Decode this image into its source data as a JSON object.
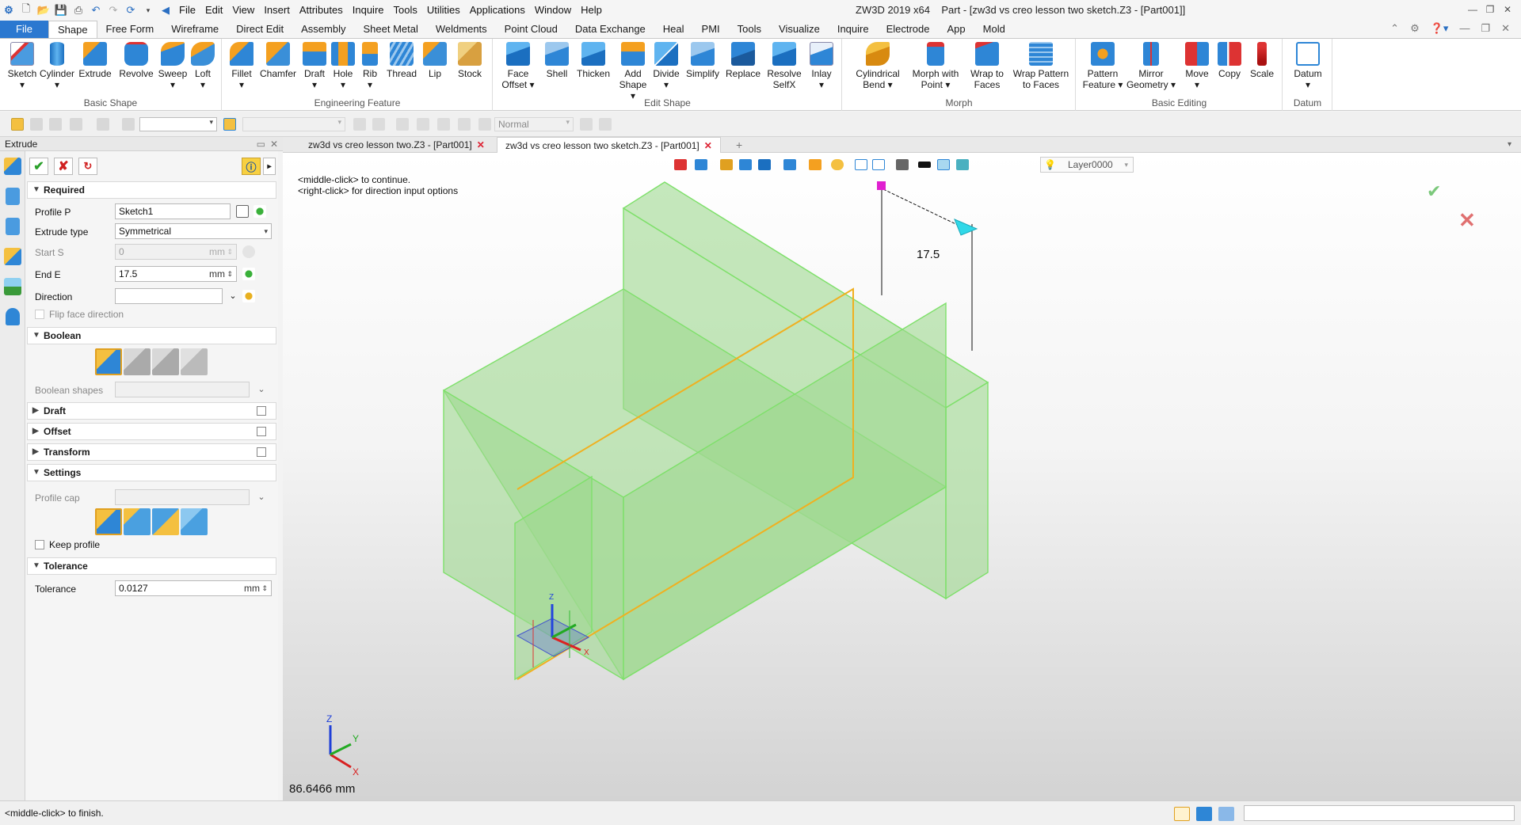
{
  "titlebar": {
    "menus": [
      "File",
      "Edit",
      "View",
      "Insert",
      "Attributes",
      "Inquire",
      "Tools",
      "Utilities",
      "Applications",
      "Window",
      "Help"
    ],
    "app_title": "ZW3D 2019  x64",
    "doc_title": "Part - [zw3d vs creo lesson two sketch.Z3 - [Part001]]"
  },
  "ribbon_tabs": [
    "File",
    "Shape",
    "Free Form",
    "Wireframe",
    "Direct Edit",
    "Assembly",
    "Sheet Metal",
    "Weldments",
    "Point Cloud",
    "Data Exchange",
    "Heal",
    "PMI",
    "Tools",
    "Visualize",
    "Inquire",
    "Electrode",
    "App",
    "Mold"
  ],
  "ribbon_active": "Shape",
  "ribbon_groups": {
    "basic_shape": {
      "label": "Basic Shape",
      "buttons": [
        {
          "line1": "Sketch",
          "line2": "▾"
        },
        {
          "line1": "Cylinder",
          "line2": "▾"
        },
        {
          "line1": "Extrude",
          "line2": ""
        },
        {
          "line1": "Revolve",
          "line2": ""
        },
        {
          "line1": "Sweep",
          "line2": "▾"
        },
        {
          "line1": "Loft",
          "line2": "▾"
        }
      ]
    },
    "engineering_feature": {
      "label": "Engineering Feature",
      "buttons": [
        {
          "line1": "Fillet",
          "line2": "▾"
        },
        {
          "line1": "Chamfer",
          "line2": ""
        },
        {
          "line1": "Draft",
          "line2": "▾"
        },
        {
          "line1": "Hole",
          "line2": "▾"
        },
        {
          "line1": "Rib",
          "line2": "▾"
        },
        {
          "line1": "Thread",
          "line2": ""
        },
        {
          "line1": "Lip",
          "line2": ""
        },
        {
          "line1": "Stock",
          "line2": ""
        }
      ]
    },
    "edit_shape": {
      "label": "Edit Shape",
      "buttons": [
        {
          "line1": "Face",
          "line2": "Offset ▾"
        },
        {
          "line1": "Shell",
          "line2": ""
        },
        {
          "line1": "Thicken",
          "line2": ""
        },
        {
          "line1": "Add",
          "line2": "Shape ▾"
        },
        {
          "line1": "Divide",
          "line2": "▾"
        },
        {
          "line1": "Simplify",
          "line2": ""
        },
        {
          "line1": "Replace",
          "line2": ""
        },
        {
          "line1": "Resolve",
          "line2": "SelfX"
        },
        {
          "line1": "Inlay",
          "line2": "▾"
        }
      ]
    },
    "morph": {
      "label": "Morph",
      "buttons": [
        {
          "line1": "Cylindrical",
          "line2": "Bend ▾"
        },
        {
          "line1": "Morph with",
          "line2": "Point ▾"
        },
        {
          "line1": "Wrap to",
          "line2": "Faces"
        },
        {
          "line1": "Wrap Pattern",
          "line2": "to Faces"
        }
      ]
    },
    "basic_editing": {
      "label": "Basic Editing",
      "buttons": [
        {
          "line1": "Pattern",
          "line2": "Feature ▾"
        },
        {
          "line1": "Mirror",
          "line2": "Geometry ▾"
        },
        {
          "line1": "Move",
          "line2": "▾"
        },
        {
          "line1": "Copy",
          "line2": ""
        },
        {
          "line1": "Scale",
          "line2": ""
        }
      ]
    },
    "datum": {
      "label": "Datum",
      "buttons": [
        {
          "line1": "Datum",
          "line2": "▾"
        }
      ]
    }
  },
  "toolbar2": {
    "filter_value": "Normal"
  },
  "panel": {
    "title": "Extrude",
    "sections": {
      "required": "Required",
      "boolean": "Boolean",
      "draft": "Draft",
      "offset": "Offset",
      "transform": "Transform",
      "settings": "Settings",
      "tolerance": "Tolerance"
    },
    "fields": {
      "profile_label": "Profile P",
      "profile_value": "Sketch1",
      "extrude_type_label": "Extrude type",
      "extrude_type_value": "Symmetrical",
      "start_label": "Start S",
      "start_value": "0",
      "start_unit": "mm",
      "end_label": "End E",
      "end_value": "17.5",
      "end_unit": "mm",
      "direction_label": "Direction",
      "flip_label": "Flip face direction",
      "boolean_shapes_label": "Boolean shapes",
      "profile_cap_label": "Profile cap",
      "keep_profile_label": "Keep profile",
      "tolerance_label": "Tolerance",
      "tolerance_value": "0.0127",
      "tolerance_unit": "mm"
    }
  },
  "doc_tabs": [
    {
      "label": "zw3d vs creo lesson two.Z3 - [Part001]",
      "active": false
    },
    {
      "label": "zw3d vs creo lesson two sketch.Z3 - [Part001]",
      "active": true
    }
  ],
  "viewport": {
    "layer": "Layer0000",
    "prompt_line1": "<middle-click> to continue.",
    "prompt_line2": "<right-click> for direction input options",
    "dimension": "17.5",
    "measure": "86.6466 mm",
    "triad": {
      "z": "Z",
      "y": "Y",
      "x": "X"
    },
    "colors": {
      "solid_fill": "#9fd98f",
      "solid_edge": "#7ee06a",
      "profile": "#f0b020",
      "handle": "#e020d0",
      "arrow": "#30d8e8"
    }
  },
  "statusbar": {
    "text": "<middle-click> to finish."
  }
}
